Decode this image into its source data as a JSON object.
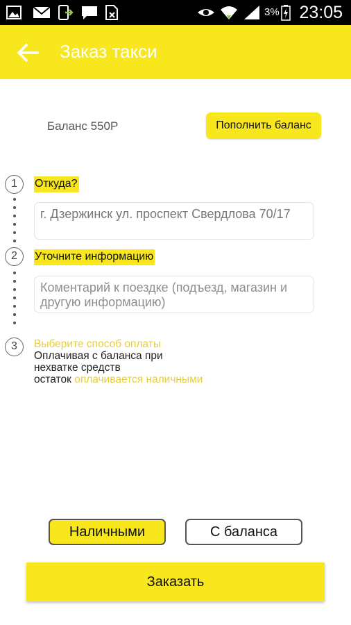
{
  "status_bar": {
    "icons": [
      "image-icon",
      "mail-icon",
      "download-icon",
      "chat-icon",
      "sim-icon",
      "eye-icon",
      "wifi-icon",
      "signal-icon",
      "battery-icon"
    ],
    "battery": "3%",
    "time": "23:05"
  },
  "app_bar": {
    "back_icon": "arrow-left-icon",
    "title": "Заказ такси"
  },
  "balance": {
    "text": "Баланс 550Р",
    "topup_label": "Пополнить баланс"
  },
  "steps": [
    {
      "number": "1",
      "label": "Откуда?",
      "field_value": "г. Дзержинск ул. проспект Свердлова 70/17"
    },
    {
      "number": "2",
      "label": "Уточните информацию",
      "field_placeholder": "Коментарий к поездке (подъезд, магазин и другую информацию)"
    },
    {
      "number": "3",
      "label": "Выберите способ оплаты",
      "note_line1": "Оплачивая с баланса при",
      "note_line2": "нехватке средств",
      "note_line3_prefix": "остаток",
      "note_line3_highlight": "оплачивается наличными"
    }
  ],
  "payment": {
    "cash_label": "Наличными",
    "balance_label": "С баланса",
    "selected": "Наличными"
  },
  "order_button": "Заказать",
  "colors": {
    "accent": "#f8e71c",
    "status_bar": "#000000"
  }
}
